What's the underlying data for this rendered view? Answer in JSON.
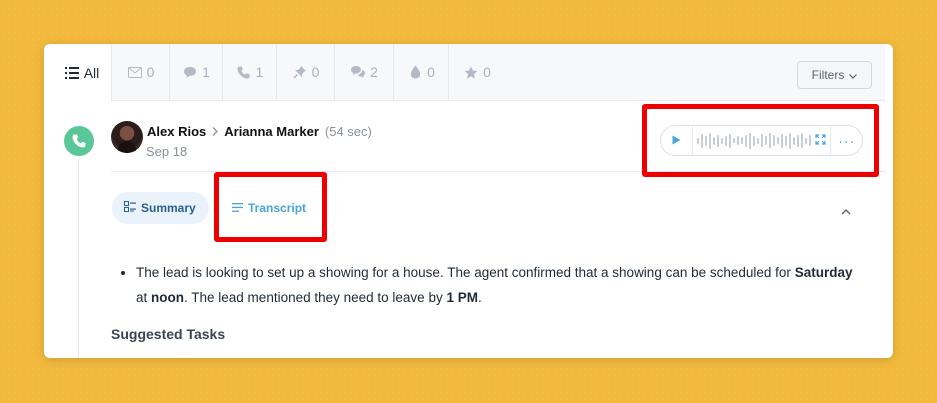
{
  "tabs": [
    {
      "name": "all",
      "label": "All",
      "icon": "list-icon",
      "count": ""
    },
    {
      "name": "email",
      "label": "",
      "icon": "envelope-icon",
      "count": "0"
    },
    {
      "name": "text",
      "label": "",
      "icon": "chat-bubble-icon",
      "count": "1"
    },
    {
      "name": "calls",
      "label": "",
      "icon": "phone-icon",
      "count": "1"
    },
    {
      "name": "notes",
      "label": "",
      "icon": "pin-icon",
      "count": "0"
    },
    {
      "name": "conversations",
      "label": "",
      "icon": "chat-bubbles-icon",
      "count": "2"
    },
    {
      "name": "drips",
      "label": "",
      "icon": "drop-icon",
      "count": "0"
    },
    {
      "name": "starred",
      "label": "",
      "icon": "star-icon",
      "count": "0"
    }
  ],
  "filters": {
    "label": "Filters"
  },
  "call": {
    "from": "Alex Rios",
    "to": "Arianna Marker",
    "duration": "(54 sec)",
    "date": "Sep 18"
  },
  "view_tabs": {
    "summary": "Summary",
    "transcript": "Transcript"
  },
  "summary": {
    "bullet_part1": "The lead is looking to set up a showing for a house. The agent confirmed that a showing can be scheduled for",
    "bold1": "Saturday",
    "part2": " at ",
    "bold2": "noon",
    "part3": ". The lead mentioned they need to leave by ",
    "bold3": "1 PM",
    "part4": "."
  },
  "suggested_tasks_heading": "Suggested Tasks",
  "colors": {
    "accent": "#4aa3d9",
    "call_badge": "#59c797",
    "highlight": "#ee0000",
    "background": "#f2b93c"
  }
}
